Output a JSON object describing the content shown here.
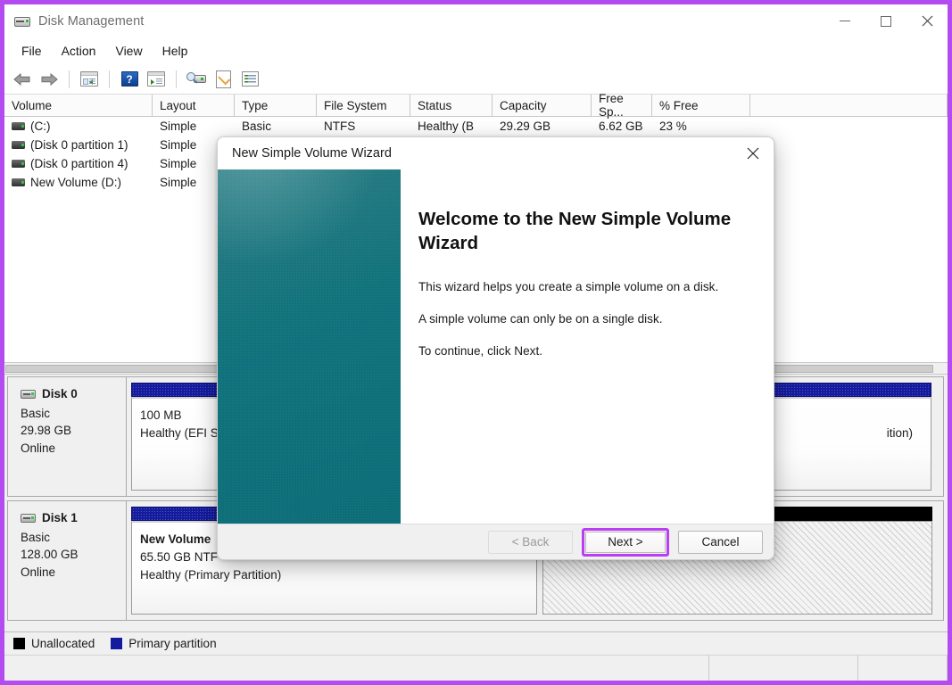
{
  "window": {
    "title": "Disk Management",
    "icon": "disk-icon",
    "controls": {
      "minimize": "—",
      "maximize": "□",
      "close": "✕"
    }
  },
  "menubar": {
    "items": [
      "File",
      "Action",
      "View",
      "Help"
    ]
  },
  "toolbar": {
    "buttons": [
      {
        "name": "back-icon",
        "label": "Back"
      },
      {
        "name": "forward-icon",
        "label": "Forward"
      },
      {
        "name": "show-hide-console-tree-icon",
        "label": "Show/Hide Console Tree"
      },
      {
        "name": "help-icon",
        "label": "Help"
      },
      {
        "name": "show-hide-action-pane-icon",
        "label": "Show/Hide Action Pane"
      },
      {
        "name": "rescan-disks-icon",
        "label": "Rescan Disks"
      },
      {
        "name": "properties-icon",
        "label": "Properties"
      },
      {
        "name": "all-tasks-icon",
        "label": "All Tasks"
      }
    ]
  },
  "volume_list": {
    "columns": [
      "Volume",
      "Layout",
      "Type",
      "File System",
      "Status",
      "Capacity",
      "Free Sp...",
      "% Free"
    ],
    "rows": [
      {
        "volume": "(C:)",
        "layout": "Simple",
        "type": "Basic",
        "file_system": "NTFS",
        "status": "Healthy (B",
        "capacity": "29.29 GB",
        "free_space": "6.62 GB",
        "percent_free": "23 %"
      },
      {
        "volume": "(Disk 0 partition 1)",
        "layout": "Simple",
        "type": "",
        "file_system": "",
        "status": "",
        "capacity": "",
        "free_space": "",
        "percent_free": ""
      },
      {
        "volume": "(Disk 0 partition 4)",
        "layout": "Simple",
        "type": "",
        "file_system": "",
        "status": "",
        "capacity": "",
        "free_space": "",
        "percent_free": ""
      },
      {
        "volume": "New Volume (D:)",
        "layout": "Simple",
        "type": "",
        "file_system": "",
        "status": "",
        "capacity": "",
        "free_space": "",
        "percent_free": ""
      }
    ]
  },
  "disks": [
    {
      "name": "Disk 0",
      "type": "Basic",
      "size": "29.98 GB",
      "state": "Online",
      "partitions": [
        {
          "size": "100 MB",
          "status": "Healthy (EFI S",
          "kind": "primary"
        },
        {
          "size": "",
          "status": "ition)",
          "kind": "primary"
        }
      ]
    },
    {
      "name": "Disk 1",
      "type": "Basic",
      "size": "128.00 GB",
      "state": "Online",
      "partitions": [
        {
          "label": "New Volume",
          "size": "65.50 GB NTF",
          "status": "Healthy (Primary Partition)",
          "kind": "primary"
        },
        {
          "label": "",
          "size": "Unallocated",
          "status": "",
          "kind": "unallocated"
        }
      ]
    }
  ],
  "legend": [
    {
      "label": "Unallocated",
      "color": "#000000"
    },
    {
      "label": "Primary partition",
      "color": "#151b9e"
    }
  ],
  "wizard": {
    "title": "New Simple Volume Wizard",
    "close_icon": "close-icon",
    "heading": "Welcome to the New Simple Volume Wizard",
    "paragraphs": [
      "This wizard helps you create a simple volume on a disk.",
      "A simple volume can only be on a single disk.",
      "To continue, click Next."
    ],
    "buttons": {
      "back": "< Back",
      "next": "Next >",
      "cancel": "Cancel"
    },
    "highlight_color": "#bb3ef5"
  }
}
